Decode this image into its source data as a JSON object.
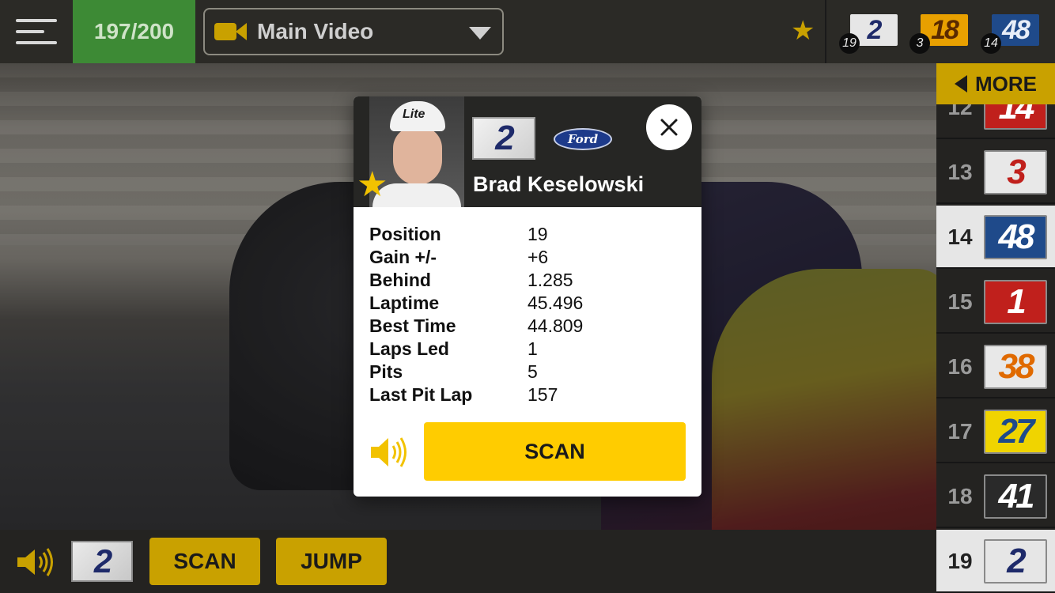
{
  "topbar": {
    "lap_counter": "197/200",
    "video_select": {
      "label": "Main Video",
      "icon": "video-camera-icon"
    },
    "favorite_icon": "star-icon",
    "favorite_cars": [
      {
        "number": "2",
        "position": "19",
        "colors": {
          "bg": "#e6e6e6",
          "fg": "#1e2a6a"
        }
      },
      {
        "number": "18",
        "position": "3",
        "colors": {
          "bg": "#e8a000",
          "fg": "#5a2a00"
        }
      },
      {
        "number": "48",
        "position": "14",
        "colors": {
          "bg": "#1f4a8a",
          "fg": "#e8eef8"
        }
      }
    ]
  },
  "sidebar": {
    "more_label": "MORE",
    "rows": [
      {
        "position": "12",
        "number": "14",
        "highlighted": false,
        "colors": {
          "bg": "#c0201c",
          "fg": "#ffffff"
        }
      },
      {
        "position": "13",
        "number": "3",
        "highlighted": false,
        "colors": {
          "bg": "#e8e8e8",
          "fg": "#c0201c"
        }
      },
      {
        "position": "14",
        "number": "48",
        "highlighted": true,
        "colors": {
          "bg": "#1f4a8a",
          "fg": "#ffffff"
        }
      },
      {
        "position": "15",
        "number": "1",
        "highlighted": false,
        "colors": {
          "bg": "#c0201c",
          "fg": "#ffffff"
        }
      },
      {
        "position": "16",
        "number": "38",
        "highlighted": false,
        "colors": {
          "bg": "#e8e8e8",
          "fg": "#e06a00"
        }
      },
      {
        "position": "17",
        "number": "27",
        "highlighted": false,
        "colors": {
          "bg": "#f0d400",
          "fg": "#1f4a8a"
        }
      },
      {
        "position": "18",
        "number": "41",
        "highlighted": false,
        "colors": {
          "bg": "#2a2a2a",
          "fg": "#ffffff"
        }
      },
      {
        "position": "19",
        "number": "2",
        "highlighted": true,
        "colors": {
          "bg": "#e6e6e6",
          "fg": "#1e2a6a"
        }
      }
    ]
  },
  "bottombar": {
    "car_number": "2",
    "scan_label": "SCAN",
    "jump_label": "JUMP"
  },
  "popup": {
    "driver_name": "Brad Keselowski",
    "car_number": "2",
    "manufacturer": "Ford",
    "cap_brand": "Lite",
    "stats": [
      {
        "label": "Position",
        "value": "19"
      },
      {
        "label": "Gain +/-",
        "value": "+6"
      },
      {
        "label": "Behind",
        "value": "1.285"
      },
      {
        "label": "Laptime",
        "value": "45.496"
      },
      {
        "label": "Best Time",
        "value": "44.809"
      },
      {
        "label": "Laps Led",
        "value": "1"
      },
      {
        "label": "Pits",
        "value": "5"
      },
      {
        "label": "Last Pit Lap",
        "value": "157"
      }
    ],
    "scan_label": "SCAN"
  },
  "colors": {
    "accent_gold": "#c9a100",
    "scan_yellow": "#ffcc00",
    "lap_green": "#3d8a35",
    "bar_dark": "#2b2a26"
  }
}
